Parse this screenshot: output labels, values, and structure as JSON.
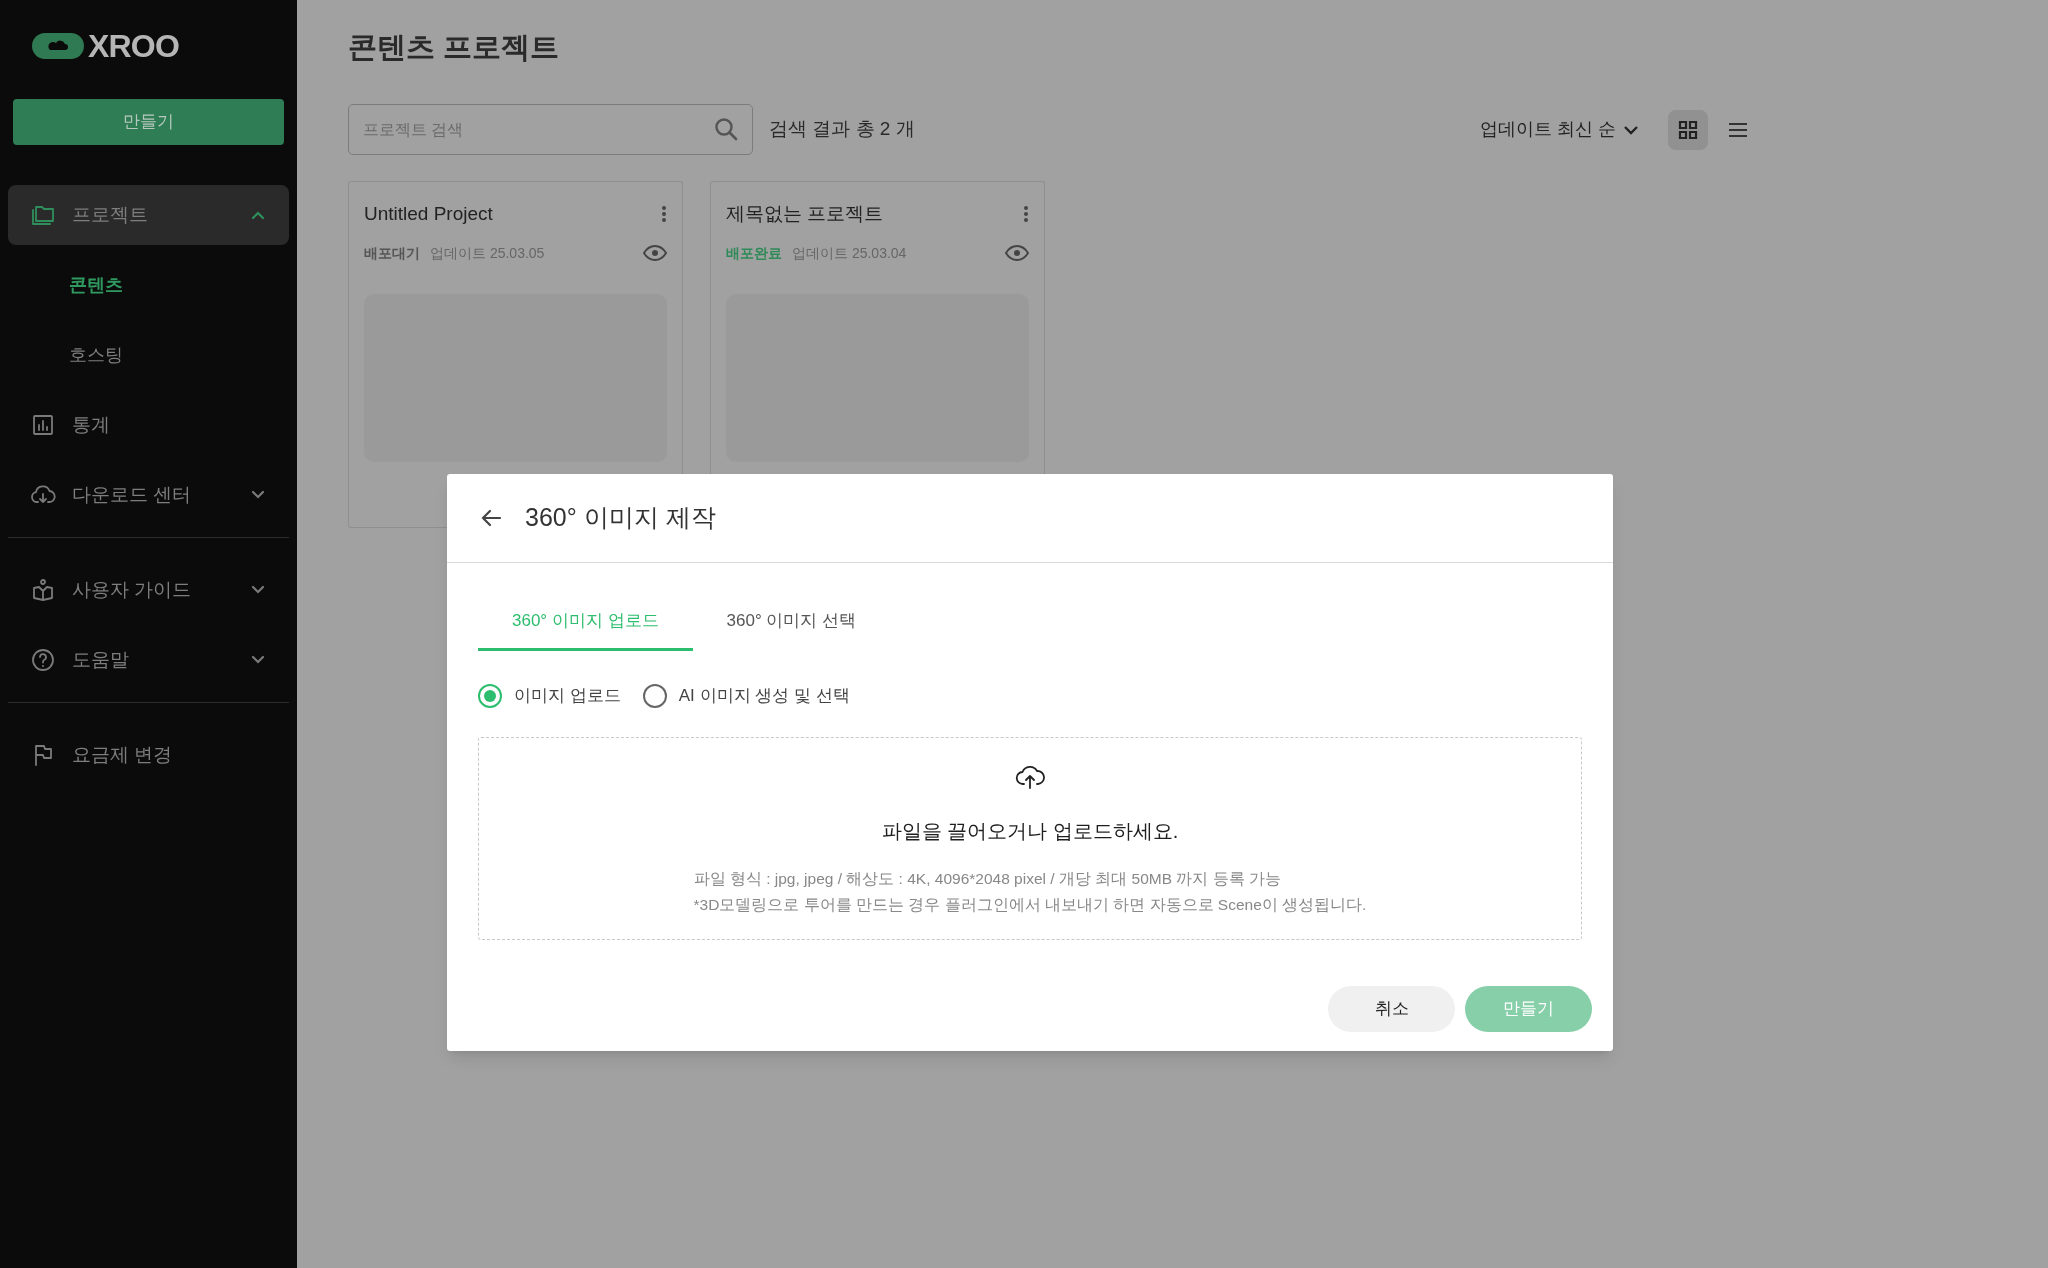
{
  "sidebar": {
    "logo": "XROO",
    "create_button": "만들기",
    "sections": [
      [
        {
          "label": "프로젝트",
          "selected": true,
          "expanded": true,
          "children": [
            {
              "label": "콘텐츠",
              "selected": true
            },
            {
              "label": "호스팅",
              "selected": false
            }
          ]
        },
        {
          "label": "통계",
          "selected": false
        },
        {
          "label": "다운로드 센터",
          "selected": false,
          "expanded": false
        }
      ],
      [
        {
          "label": "사용자 가이드",
          "selected": false,
          "expanded": false
        },
        {
          "label": "도움말",
          "selected": false,
          "expanded": false
        }
      ],
      [
        {
          "label": "요금제 변경",
          "selected": false
        }
      ]
    ]
  },
  "main": {
    "title": "콘텐츠 프로젝트",
    "search": {
      "placeholder": "프로젝트 검색"
    },
    "result_count": "검색 결과 총 2 개",
    "sort": "업데이트 최신 순",
    "view_modes": [
      {
        "kind": "grid",
        "selected": true
      },
      {
        "kind": "list",
        "selected": false
      }
    ],
    "cards": [
      {
        "title": "Untitled Project",
        "status": "배포대기",
        "deployed": false,
        "updated": "업데이트 25.03.05"
      },
      {
        "title": "제목없는 프로젝트",
        "status": "배포완료",
        "deployed": true,
        "updated": "업데이트 25.03.04"
      }
    ]
  },
  "modal": {
    "title": "360° 이미지 제작",
    "tabs": [
      {
        "label": "360° 이미지 업로드",
        "selected": true
      },
      {
        "label": "360° 이미지 선택",
        "selected": false
      }
    ],
    "radios": [
      {
        "label": "이미지 업로드",
        "selected": true
      },
      {
        "label": "AI 이미지 생성 및 선택",
        "selected": false
      }
    ],
    "dropzone": {
      "heading": "파일을 끌어오거나 업로드하세요.",
      "notes": [
        "파일 형식 : jpg, jpeg / 해상도 : 4K, 4096*2048 pixel / 개당 최대 50MB 까지 등록 가능",
        "*3D모델링으로 투어를 만드는 경우 플러그인에서 내보내기 하면 자동으로 Scene이 생성됩니다."
      ]
    },
    "cancel_button": "취소",
    "create_button": {
      "label": "만들기",
      "disabled": true
    }
  }
}
